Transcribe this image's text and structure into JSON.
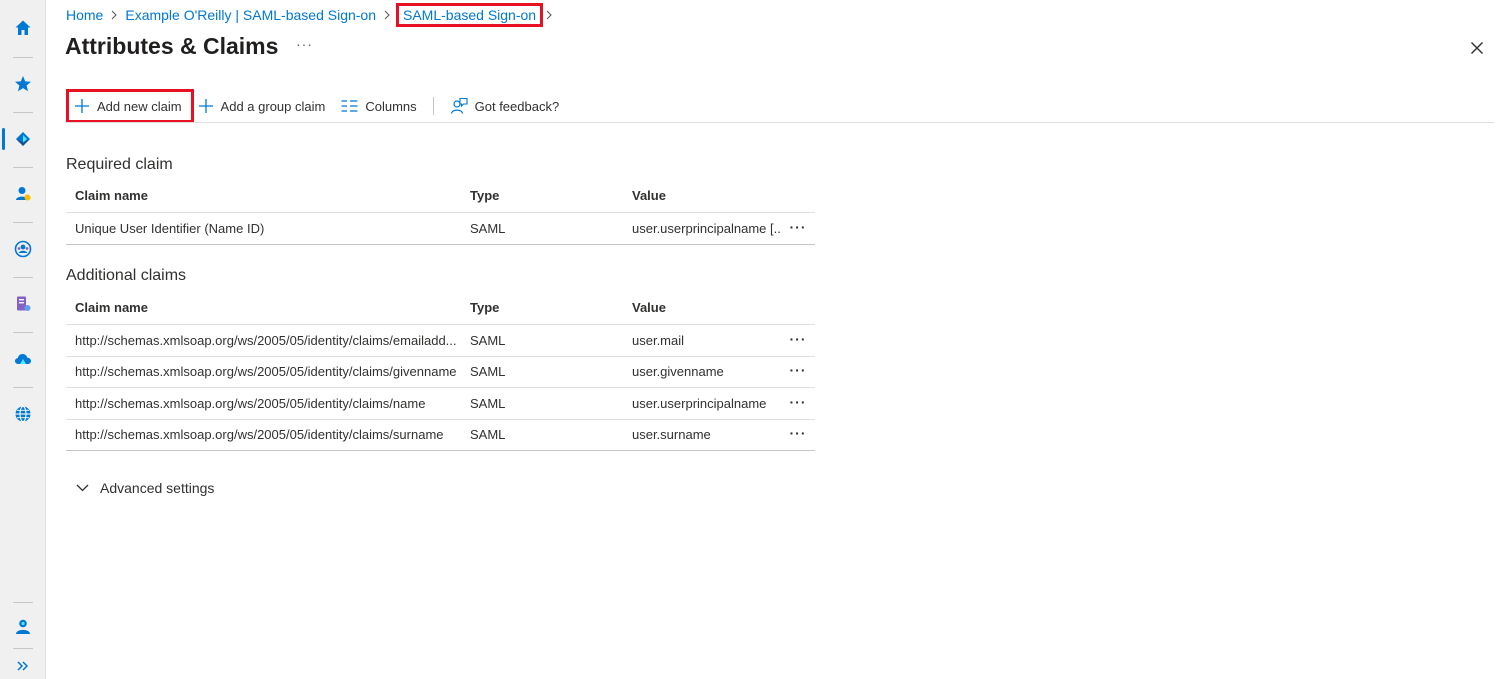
{
  "rail": {
    "items": [
      "home-icon",
      "star-icon",
      "entra-diamond-icon",
      "users-icon",
      "groups-icon",
      "app-registrations-icon",
      "cloud-icon",
      "globe-icon"
    ],
    "bottom": [
      "user-settings-icon",
      "expand-chevrons-icon"
    ]
  },
  "breadcrumb": {
    "home": "Home",
    "app": "Example O'Reilly | SAML-based Sign-on",
    "current": "SAML-based Sign-on"
  },
  "page": {
    "title": "Attributes & Claims",
    "more": "···"
  },
  "toolbar": {
    "add_claim": "Add new claim",
    "add_group": "Add a group claim",
    "columns": "Columns",
    "feedback": "Got feedback?"
  },
  "columns": {
    "name": "Claim name",
    "type": "Type",
    "value": "Value"
  },
  "required": {
    "title": "Required claim",
    "rows": [
      {
        "name": "Unique User Identifier (Name ID)",
        "type": "SAML",
        "value": "user.userprincipalname [..."
      }
    ]
  },
  "additional": {
    "title": "Additional claims",
    "rows": [
      {
        "name": "http://schemas.xmlsoap.org/ws/2005/05/identity/claims/emailadd...",
        "type": "SAML",
        "value": "user.mail"
      },
      {
        "name": "http://schemas.xmlsoap.org/ws/2005/05/identity/claims/givenname",
        "type": "SAML",
        "value": "user.givenname"
      },
      {
        "name": "http://schemas.xmlsoap.org/ws/2005/05/identity/claims/name",
        "type": "SAML",
        "value": "user.userprincipalname"
      },
      {
        "name": "http://schemas.xmlsoap.org/ws/2005/05/identity/claims/surname",
        "type": "SAML",
        "value": "user.surname"
      }
    ]
  },
  "row_more": "···",
  "advanced": {
    "label": "Advanced settings"
  },
  "colors": {
    "accent": "#0078d4",
    "highlight": "#e81123"
  }
}
